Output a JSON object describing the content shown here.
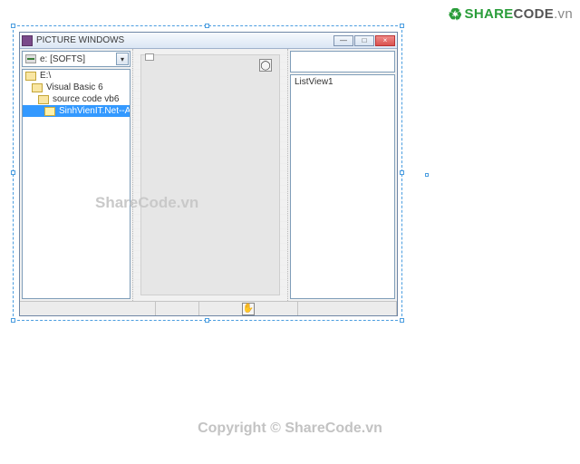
{
  "brand": {
    "share": "SHARE",
    "code": "CODE",
    "ext": ".vn"
  },
  "window": {
    "title": "PICTURE WINDOWS",
    "buttons": {
      "min": "—",
      "max": "□",
      "close": "×"
    }
  },
  "drive": {
    "label": "e: [SOFTS]",
    "arrow": "▾"
  },
  "dirs": {
    "0": {
      "label": "E:\\"
    },
    "1": {
      "label": "Visual Basic 6"
    },
    "2": {
      "label": "source code vb6"
    },
    "3": {
      "label": "SinhVienIT.Net--ACDNew"
    }
  },
  "midPanel": {
    "playGlyph": "◯"
  },
  "rightPanel": {
    "listviewLabel": "ListView1"
  },
  "statusbar": {
    "handGlyph": "✋"
  },
  "watermarks": {
    "mid": "ShareCode.vn",
    "bottom": "Copyright © ShareCode.vn"
  }
}
